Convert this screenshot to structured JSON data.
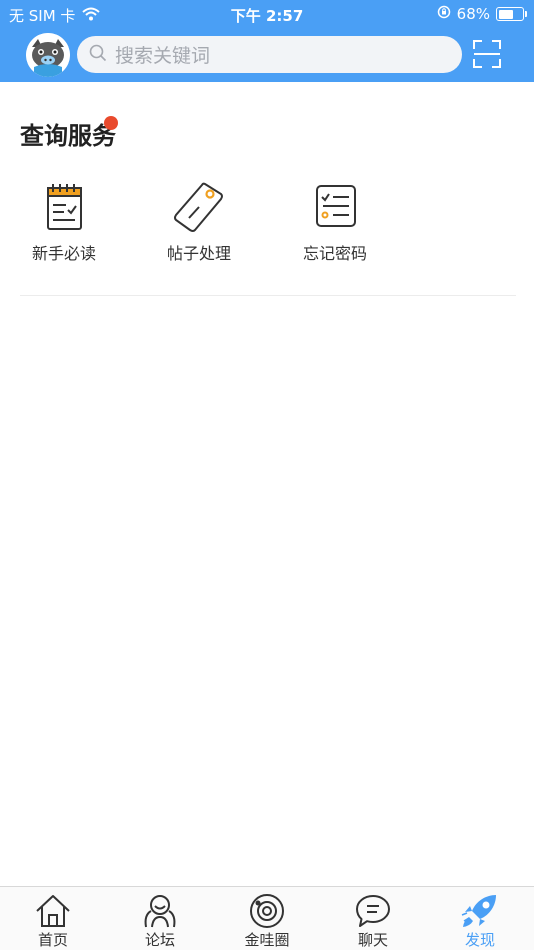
{
  "status_bar": {
    "carrier": "无 SIM 卡",
    "time": "下午 2:57",
    "battery": "68%",
    "battery_level": 0.68
  },
  "header": {
    "search_placeholder": "搜索关键词",
    "avatar_icon": "pig-avatar-icon",
    "scan_icon": "scan-icon"
  },
  "section": {
    "title": "查询服务",
    "services": [
      {
        "label": "新手必读",
        "icon": "notebook-icon"
      },
      {
        "label": "帖子处理",
        "icon": "tag-icon"
      },
      {
        "label": "忘记密码",
        "icon": "checklist-icon"
      }
    ]
  },
  "tabbar": {
    "tabs": [
      {
        "label": "首页",
        "icon": "home-icon"
      },
      {
        "label": "论坛",
        "icon": "forum-icon"
      },
      {
        "label": "金哇圈",
        "icon": "circle-icon"
      },
      {
        "label": "聊天",
        "icon": "chat-icon"
      },
      {
        "label": "发现",
        "icon": "rocket-icon",
        "active": true
      }
    ]
  },
  "colors": {
    "brand": "#4a9ff5",
    "accent_orange": "#f0a020",
    "badge_red": "#e94a2d"
  }
}
